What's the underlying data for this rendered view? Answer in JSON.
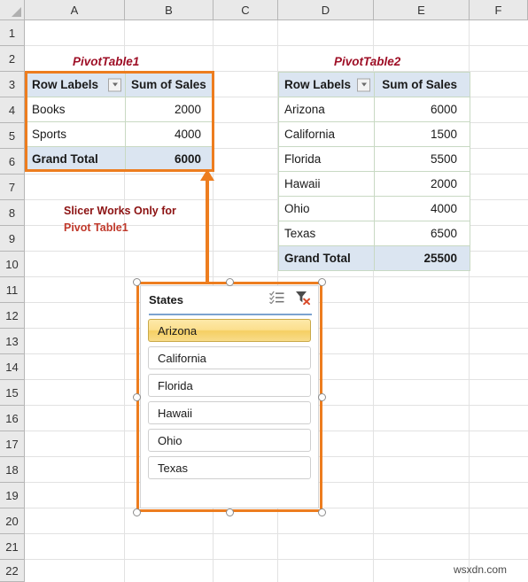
{
  "spreadsheet": {
    "column_headers": [
      "A",
      "B",
      "C",
      "D",
      "E",
      "F"
    ],
    "row_headers": [
      "1",
      "2",
      "3",
      "4",
      "5",
      "6",
      "7",
      "8",
      "9",
      "10",
      "11",
      "12",
      "13",
      "14",
      "15",
      "16",
      "17",
      "18",
      "19",
      "20",
      "21",
      "22"
    ],
    "corner_name": "select-all-corner"
  },
  "pivot_table_1": {
    "title": "PivotTable1",
    "headers": [
      "Row Labels",
      "Sum of Sales"
    ],
    "rows": [
      {
        "label": "Books",
        "value": "2000"
      },
      {
        "label": "Sports",
        "value": "4000"
      }
    ],
    "grand_total": {
      "label": "Grand Total",
      "value": "6000"
    }
  },
  "pivot_table_2": {
    "title": "PivotTable2",
    "headers": [
      "Row Labels",
      "Sum of Sales"
    ],
    "rows": [
      {
        "label": "Arizona",
        "value": "6000"
      },
      {
        "label": "California",
        "value": "1500"
      },
      {
        "label": "Florida",
        "value": "5500"
      },
      {
        "label": "Hawaii",
        "value": "2000"
      },
      {
        "label": "Ohio",
        "value": "4000"
      },
      {
        "label": "Texas",
        "value": "6500"
      }
    ],
    "grand_total": {
      "label": "Grand Total",
      "value": "25500"
    }
  },
  "annotation": {
    "line1": "Slicer Works Only for",
    "line2": "Pivot Table1"
  },
  "slicer": {
    "title": "States",
    "multiselect_icon": "multi-select-icon",
    "clear_filter_icon": "clear-filter-icon",
    "items": [
      {
        "label": "Arizona",
        "selected": true
      },
      {
        "label": "California",
        "selected": false
      },
      {
        "label": "Florida",
        "selected": false
      },
      {
        "label": "Hawaii",
        "selected": false
      },
      {
        "label": "Ohio",
        "selected": false
      },
      {
        "label": "Texas",
        "selected": false
      }
    ]
  },
  "watermark": {
    "text": "wsxdn.com"
  },
  "colors": {
    "accent_orange": "#ed7d1f",
    "pivot_header_fill": "#dbe5f1",
    "pivot_border": "#c8d9c3",
    "title_red": "#9e0f26",
    "annotation_dark_red": "#8c1212",
    "annotation_red": "#c0392b",
    "slicer_selected": "#f5cf63",
    "grid_line": "#e2e2e2",
    "header_fill": "#e9e9e9"
  }
}
